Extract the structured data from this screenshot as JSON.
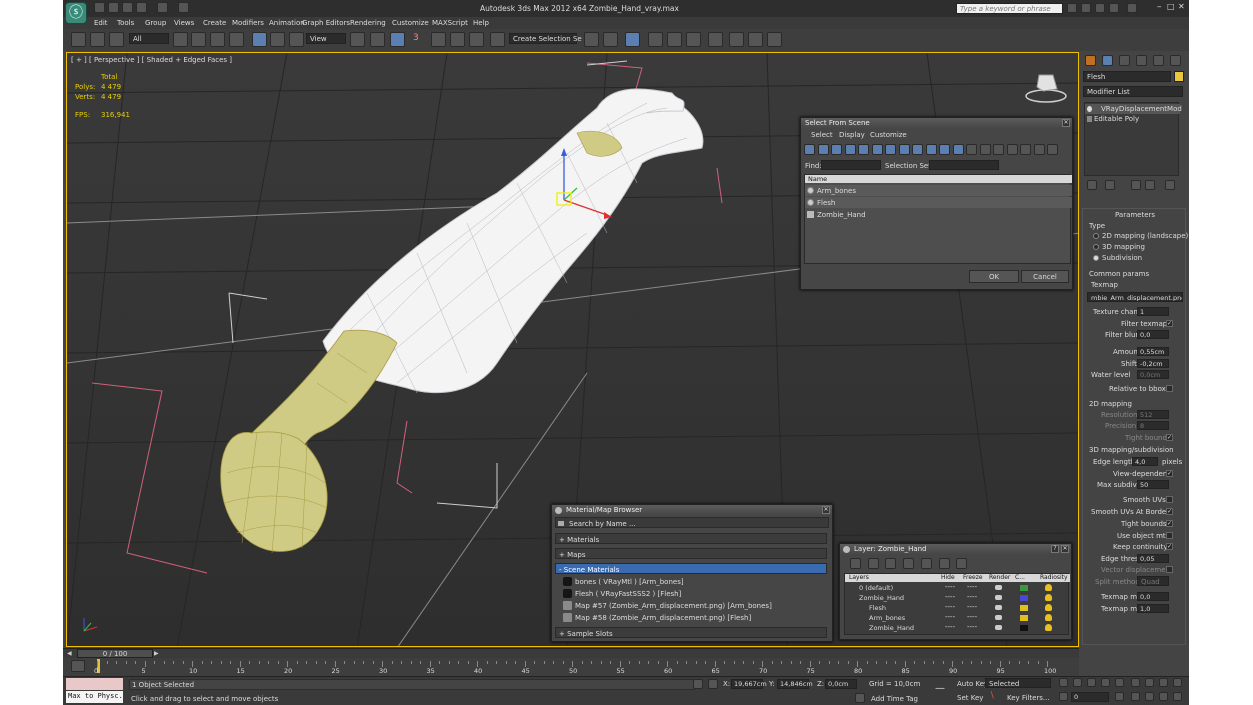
{
  "titlebar": {
    "title": "Autodesk 3ds Max  2012 x64     Zombie_Hand_vray.max",
    "search_placeholder": "Type a keyword or phrase"
  },
  "menu": [
    "Edit",
    "Tools",
    "Group",
    "Views",
    "Create",
    "Modifiers",
    "Animation",
    "Graph Editors",
    "Rendering",
    "Customize",
    "MAXScript",
    "Help"
  ],
  "toolbar": {
    "filter": "All",
    "refcoord": "View",
    "selset": "Create Selection Se",
    "snap_3": "3",
    "snap_n": "n"
  },
  "viewport": {
    "label": "[ + ] [ Perspective ] [ Shaded + Edged Faces ]",
    "stats": {
      "total_label": "Total",
      "polys_label": "Polys:",
      "polys": "4 479",
      "verts_label": "Verts:",
      "verts": "4 479",
      "fps_label": "FPS:",
      "fps": "316,941"
    }
  },
  "select_dialog": {
    "title": "Select From Scene",
    "menu": [
      "Select",
      "Display",
      "Customize"
    ],
    "find_label": "Find:",
    "selset_label": "Selection Set:",
    "col_name": "Name",
    "items": [
      "Arm_bones",
      "Flesh",
      "Zombie_Hand"
    ],
    "ok": "OK",
    "cancel": "Cancel"
  },
  "mat_browser": {
    "title": "Material/Map Browser",
    "search": "Search by Name ...",
    "groups": {
      "materials": "+ Materials",
      "maps": "+ Maps",
      "scene": "- Scene Materials",
      "sample": "+ Sample Slots"
    },
    "items": [
      "bones  ( VRayMtl ) [Arm_bones]",
      "Flesh  ( VRayFastSSS2 ) [Flesh]",
      "Map #57 (Zombie_Arm_displacement.png) [Arm_bones]",
      "Map #58 (Zombie_Arm_displacement.png) [Flesh]"
    ]
  },
  "layer_dialog": {
    "title": "Layer: Zombie_Hand",
    "help": "?",
    "cols": [
      "Layers",
      "Hide",
      "Freeze",
      "Render",
      "C...",
      "Radiosity"
    ],
    "rows": [
      {
        "name": "0 (default)",
        "color": "#3a9a3a"
      },
      {
        "name": "Zombie_Hand",
        "color": "#4a4ad0"
      },
      {
        "name": "Flesh",
        "color": "#e0c020"
      },
      {
        "name": "Arm_bones",
        "color": "#e0c020"
      },
      {
        "name": "Zombie_Hand",
        "color": "#111111"
      }
    ]
  },
  "cmd_panel": {
    "object_name": "Flesh",
    "modifier_list": "Modifier List",
    "stack": [
      "VRayDisplacementMod",
      "Editable Poly"
    ],
    "params_title": "Parameters",
    "type_label": "Type",
    "types": [
      "2D mapping (landscape)",
      "3D mapping",
      "Subdivision"
    ],
    "common": "Common params",
    "texmap_label": "Texmap",
    "texmap": "mbie_Arm_displacement.png)",
    "texture_chan_label": "Texture chan",
    "texture_chan": "1",
    "filter_texmap": "Filter texmap",
    "filter_blur_label": "Filter blur",
    "filter_blur": "0,0",
    "amount_label": "Amount",
    "amount": "0,55cm",
    "shift_label": "Shift",
    "shift": "-0,2cm",
    "water_label": "Water level",
    "water": "0,0cm",
    "relative": "Relative to bbox",
    "map2d": "2D mapping",
    "resolution_label": "Resolution",
    "resolution": "512",
    "precision_label": "Precision",
    "precision": "8",
    "tight_bounds": "Tight bounds",
    "map3d": "3D mapping/subdivision",
    "edge_len_label": "Edge length",
    "edge_len": "4,0",
    "pixels": "pixels",
    "view_dep": "View-dependent",
    "max_subdivs_label": "Max subdivs",
    "max_subdivs": "50",
    "smooth_uvs": "Smooth UVs",
    "smooth_borders": "Smooth UVs At Borders",
    "tight_bounds2": "Tight bounds",
    "use_obj_mtl": "Use object mtl",
    "keep_cont": "Keep continuity",
    "edge_thresh_label": "Edge thresh",
    "edge_thresh": "0,05",
    "vector_disp": "Vector displacement",
    "split_label": "Split method",
    "split": "Quad",
    "texmap_min_label": "Texmap min",
    "texmap_min": "0,0",
    "texmap_max_label": "Texmap max",
    "texmap_max": "1,0"
  },
  "timeline": {
    "frame": "0 / 100",
    "ticks": [
      "0",
      "5",
      "10",
      "15",
      "20",
      "25",
      "30",
      "35",
      "40",
      "45",
      "50",
      "55",
      "60",
      "65",
      "70",
      "75",
      "80",
      "85",
      "90",
      "95",
      "100"
    ]
  },
  "status": {
    "maxscript": "Max to Physc.",
    "selected": "1 Object Selected",
    "prompt": "Click and drag to select and move objects",
    "x_label": "X:",
    "x": "19,667cm",
    "y_label": "Y:",
    "y": "14,846cm",
    "z_label": "Z:",
    "z": "0,0cm",
    "grid": "Grid = 10,0cm",
    "add_time_tag": "Add Time Tag",
    "auto_key": "Auto Key",
    "set_key": "Set Key",
    "selected_dd": "Selected",
    "key_filters": "Key Filters...",
    "frame": "0"
  }
}
